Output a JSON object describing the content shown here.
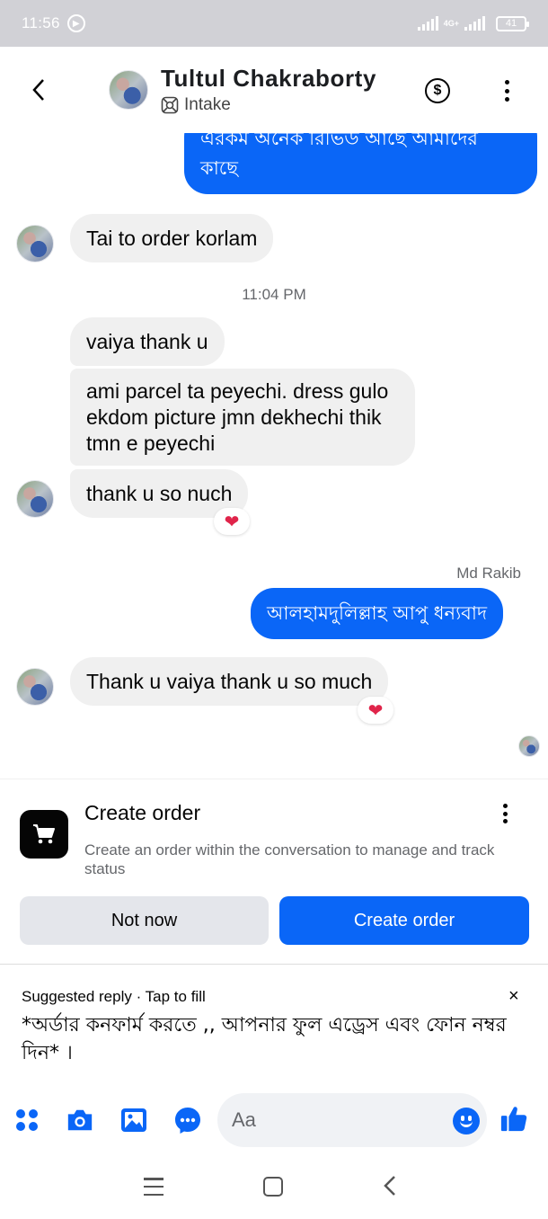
{
  "status_bar": {
    "time": "11:56",
    "network": "4G+",
    "battery": "41"
  },
  "header": {
    "contact_name": "Tultul Chakraborty",
    "subtitle": "Intake"
  },
  "messages": {
    "out1": "এরকম অনেক রিভিউ আছে আমাদের কাছে",
    "in1": "Tai to order korlam",
    "timestamp": "11:04 PM",
    "in2": "vaiya thank u",
    "in3": "ami parcel ta peyechi. dress gulo ekdom picture jmn dekhechi thik tmn e peyechi",
    "in4": "thank u so nuch",
    "in4_reaction": "❤",
    "sender_name": "Md Rakib",
    "out2": "আলহামদুলিল্লাহ আপু ধন্যবাদ",
    "in5": "Thank u vaiya thank u so much",
    "in5_reaction": "❤"
  },
  "order_card": {
    "title": "Create order",
    "description": "Create an order within the conversation to manage and track status",
    "not_now_label": "Not now",
    "create_label": "Create order"
  },
  "suggested_reply": {
    "label": "Suggested reply · Tap to fill",
    "close": "×",
    "text": "*অর্ডার কনফার্ম করতে ,, আপনার ফুল এড্রেস এবং ফোন নম্বর দিন* ।"
  },
  "composer": {
    "placeholder": "Aa"
  },
  "colors": {
    "accent": "#0a66f7",
    "incoming_bubble": "#f0f0f0",
    "reaction": "#e0244a"
  },
  "icons": [
    "back-icon",
    "intake-icon",
    "dollar-icon",
    "more-icon",
    "cart-icon",
    "apps-icon",
    "camera-icon",
    "image-icon",
    "messenger-icon",
    "emoji-icon",
    "like-icon"
  ]
}
